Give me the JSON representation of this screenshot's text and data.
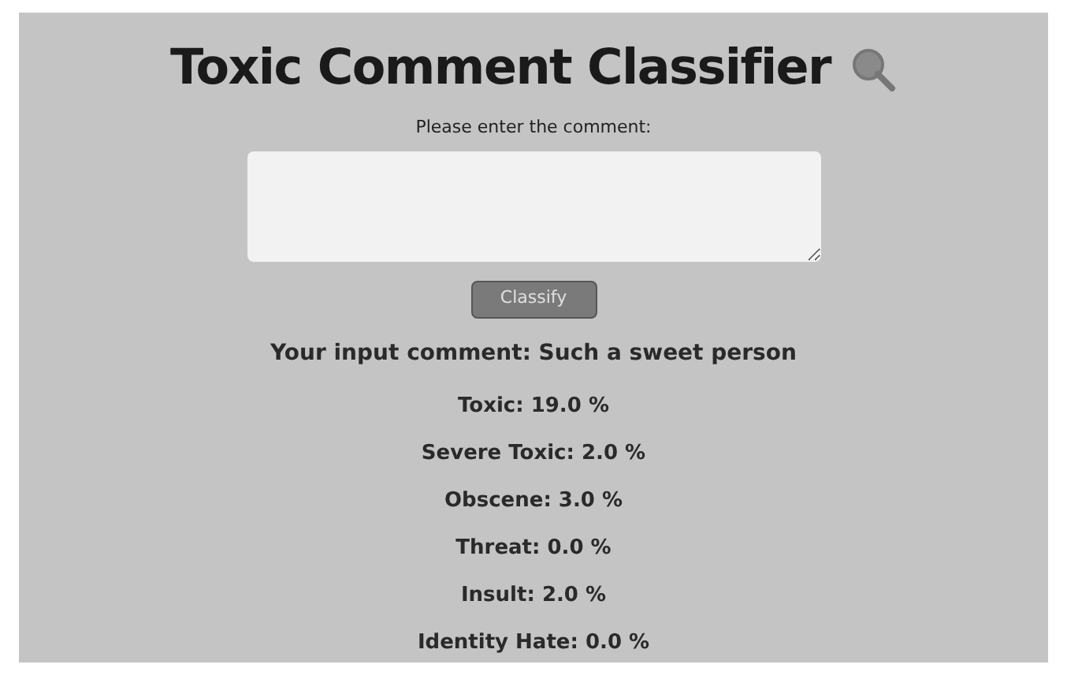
{
  "title": "Toxic Comment Classifier",
  "prompt": "Please enter the comment:",
  "classify_button": "Classify",
  "input_comment": "Your input comment: Such a sweet person",
  "results": [
    "Toxic: 19.0 %",
    "Severe Toxic: 2.0 %",
    "Obscene: 3.0 %",
    "Threat: 0.0 %",
    "Insult: 2.0 %",
    "Identity Hate: 0.0 %"
  ]
}
